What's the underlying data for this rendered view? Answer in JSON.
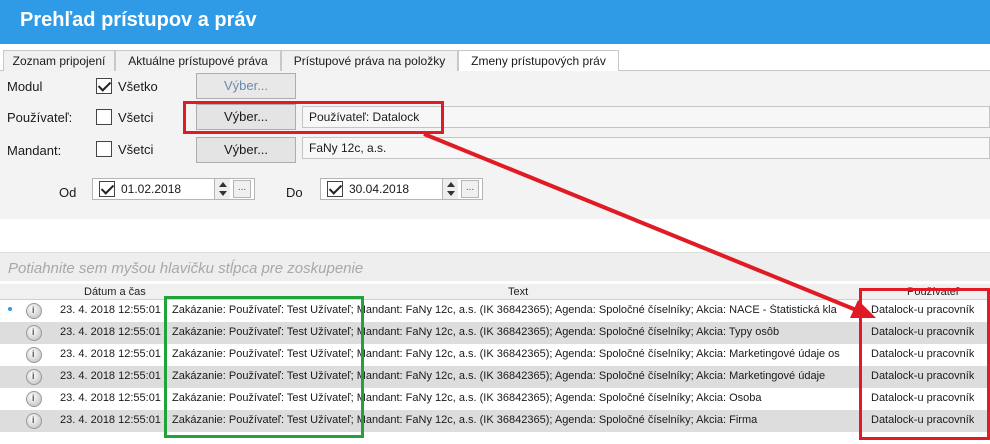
{
  "window": {
    "title": "Prehľad prístupov a práv"
  },
  "tabs": [
    {
      "label": "Zoznam pripojení",
      "active": false
    },
    {
      "label": "Aktuálne prístupové práva",
      "active": false
    },
    {
      "label": "Prístupové práva na položky",
      "active": false
    },
    {
      "label": "Zmeny prístupových práv",
      "active": true
    }
  ],
  "filters": {
    "modul": {
      "label": "Modul",
      "checkbox_label": "Všetko",
      "checked": true,
      "button": "Výber..."
    },
    "user": {
      "label": "Používateľ:",
      "checkbox_label": "Všetci",
      "checked": false,
      "button": "Výber...",
      "value": "Používateľ: Datalock"
    },
    "mandant": {
      "label": "Mandant:",
      "checkbox_label": "Všetci",
      "checked": false,
      "button": "Výber...",
      "value": "FaNy 12c, a.s."
    },
    "date_from": {
      "label": "Od",
      "value": "01.02.2018",
      "checked": true
    },
    "date_to": {
      "label": "Do",
      "value": "30.04.2018",
      "checked": true
    },
    "ellipsis": "..."
  },
  "group_hint": "Potiahnite sem myšou hlavičku stĺpca pre zoskupenie",
  "grid": {
    "columns": [
      "Dátum a čas",
      "Text",
      "Používateľ"
    ],
    "rows": [
      {
        "datetime": "23. 4. 2018 12:55:01",
        "text": "Zakázanie: Používateľ: Test Užívateľ; Mandant: FaNy 12c, a.s. (IK 36842365); Agenda: Spoločné číselníky; Akcia: NACE - Štatistická kla",
        "user": "Datalock-u pracovník"
      },
      {
        "datetime": "23. 4. 2018 12:55:01",
        "text": "Zakázanie: Používateľ: Test Užívateľ; Mandant: FaNy 12c, a.s. (IK 36842365); Agenda: Spoločné číselníky; Akcia: Typy osôb",
        "user": "Datalock-u pracovník"
      },
      {
        "datetime": "23. 4. 2018 12:55:01",
        "text": "Zakázanie: Používateľ: Test Užívateľ; Mandant: FaNy 12c, a.s. (IK 36842365); Agenda: Spoločné číselníky; Akcia: Marketingové údaje os",
        "user": "Datalock-u pracovník"
      },
      {
        "datetime": "23. 4. 2018 12:55:01",
        "text": "Zakázanie: Používateľ: Test Užívateľ; Mandant: FaNy 12c, a.s. (IK 36842365); Agenda: Spoločné číselníky; Akcia: Marketingové údaje",
        "user": "Datalock-u pracovník"
      },
      {
        "datetime": "23. 4. 2018 12:55:01",
        "text": "Zakázanie: Používateľ: Test Užívateľ; Mandant: FaNy 12c, a.s. (IK 36842365); Agenda: Spoločné číselníky; Akcia: Osoba",
        "user": "Datalock-u pracovník"
      },
      {
        "datetime": "23. 4. 2018 12:55:01",
        "text": "Zakázanie: Používateľ: Test Užívateľ; Mandant: FaNy 12c, a.s. (IK 36842365); Agenda: Spoločné číselníky; Akcia: Firma",
        "user": "Datalock-u pracovník"
      }
    ]
  },
  "colors": {
    "title_bar": "#2f9be6",
    "highlight_red": "#e01b24",
    "highlight_green": "#1fa33a"
  }
}
